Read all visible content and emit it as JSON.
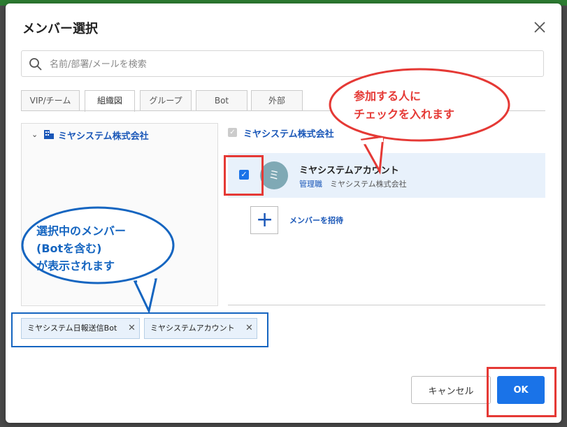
{
  "dialog": {
    "title": "メンバー選択",
    "close_icon": "close-icon"
  },
  "search": {
    "placeholder": "名前/部署/メールを検索",
    "value": "",
    "icon": "search-icon"
  },
  "tabs": [
    {
      "label": "VIP/チーム",
      "active": false
    },
    {
      "label": "組織図",
      "active": true
    },
    {
      "label": "グループ",
      "active": false
    },
    {
      "label": "Bot",
      "active": false
    },
    {
      "label": "外部",
      "active": false
    }
  ],
  "tree": {
    "root_label": "ミヤシステム株式会社",
    "icon": "building-icon",
    "expanded": true
  },
  "org_header": {
    "label": "ミヤシステム株式会社",
    "checked": true,
    "disabled": true
  },
  "member": {
    "avatar_text": "ミ",
    "name": "ミヤシステムアカウント",
    "role": "管理職",
    "company": "ミヤシステム株式会社",
    "checked": true
  },
  "invite": {
    "label": "メンバーを招待",
    "icon": "plus-icon"
  },
  "selected_chips": [
    {
      "label": "ミヤシステム日報送信Bot"
    },
    {
      "label": "ミヤシステムアカウント"
    }
  ],
  "footer": {
    "cancel_label": "キャンセル",
    "ok_label": "OK"
  },
  "annotations": {
    "red_callout_line1": "参加する人に",
    "red_callout_line2": "チェックを入れます",
    "blue_callout_line1": "選択中のメンバー",
    "blue_callout_line2": "(Botを含む)",
    "blue_callout_line3": "が表示されます"
  },
  "colors": {
    "accent": "#1a73e8",
    "link": "#1a57b8",
    "annotation_red": "#e53935",
    "annotation_blue": "#1565c0",
    "selected_row_bg": "#e8f1fb"
  }
}
